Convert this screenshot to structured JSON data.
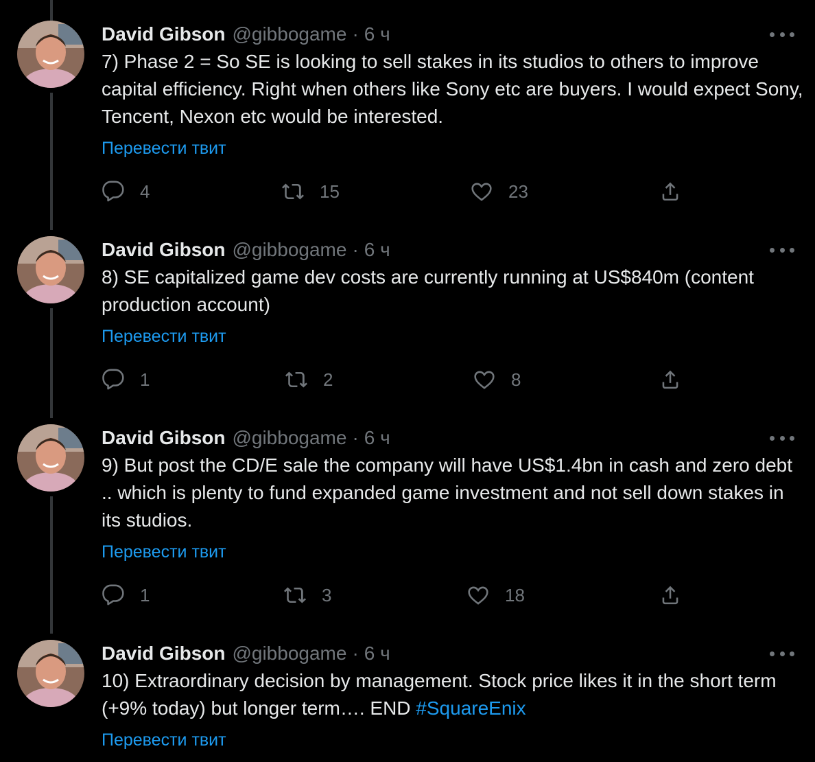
{
  "tweets": [
    {
      "name": "David Gibson",
      "handle": "@gibbogame",
      "separator": "·",
      "time": "6 ч",
      "text": "7) Phase 2 = So SE is looking to sell stakes in its studios to others to improve capital efficiency. Right when others like Sony etc are buyers. I would expect Sony, Tencent, Nexon etc would be interested.",
      "hashtag": "",
      "translate": "Перевести твит",
      "replies": "4",
      "retweets": "15",
      "likes": "23"
    },
    {
      "name": "David Gibson",
      "handle": "@gibbogame",
      "separator": "·",
      "time": "6 ч",
      "text": "8) SE capitalized game dev costs are currently running at US$840m (content production account)",
      "hashtag": "",
      "translate": "Перевести твит",
      "replies": "1",
      "retweets": "2",
      "likes": "8"
    },
    {
      "name": "David Gibson",
      "handle": "@gibbogame",
      "separator": "·",
      "time": "6 ч",
      "text": "9) But post the CD/E sale the company will have US$1.4bn in cash and zero debt .. which is plenty to fund expanded game investment and not sell down stakes in its studios.",
      "hashtag": "",
      "translate": "Перевести твит",
      "replies": "1",
      "retweets": "3",
      "likes": "18"
    },
    {
      "name": "David Gibson",
      "handle": "@gibbogame",
      "separator": "·",
      "time": "6 ч",
      "text": "10) Extraordinary decision by management. Stock price likes it in the short term (+9% today) but longer term…. END ",
      "hashtag": "#SquareEnix",
      "translate": "Перевести твит"
    }
  ],
  "icons": {
    "reply": "reply-icon",
    "retweet": "retweet-icon",
    "like": "heart-icon",
    "share": "share-icon",
    "more": "more-icon"
  },
  "colors": {
    "background": "#000000",
    "text": "#e7e9ea",
    "muted": "#71767b",
    "link": "#1d9bf0"
  }
}
